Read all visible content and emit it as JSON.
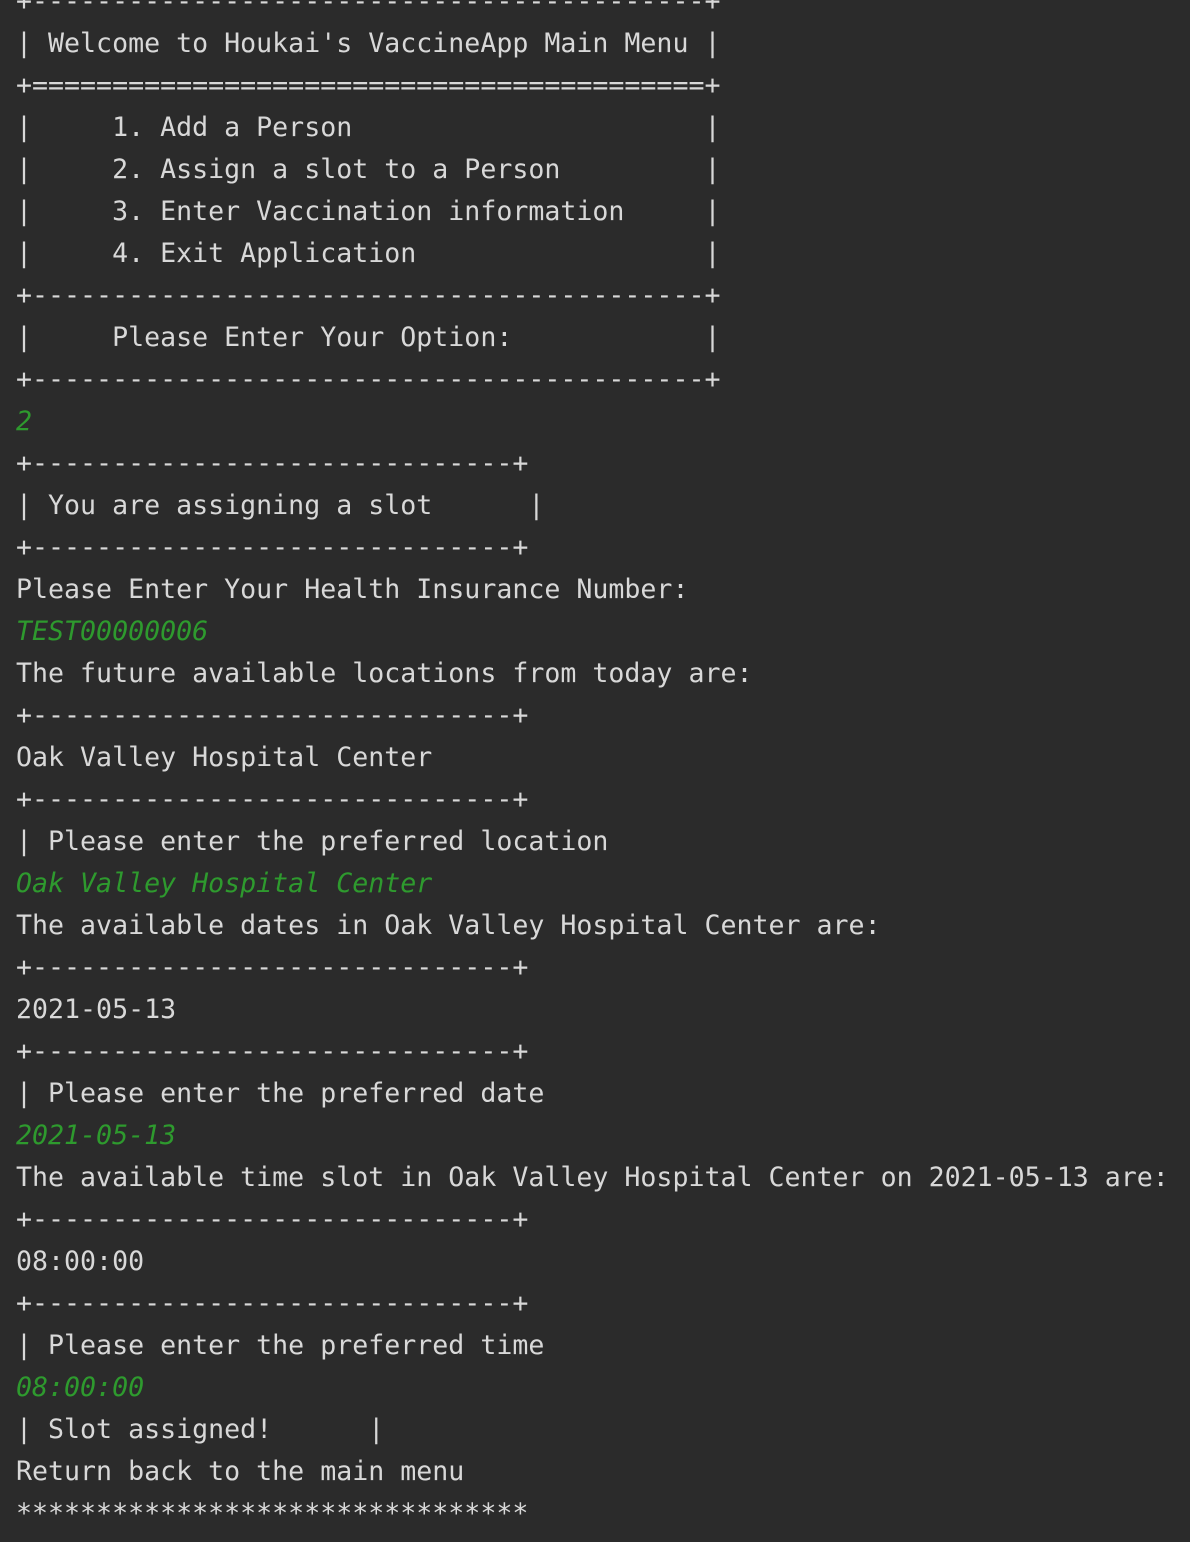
{
  "console": {
    "lines": [
      {
        "text": "+------------------------------------------+",
        "kind": "output"
      },
      {
        "text": "| Welcome to Houkai's VaccineApp Main Menu |",
        "kind": "output"
      },
      {
        "text": "+==========================================+",
        "kind": "output"
      },
      {
        "text": "|     1. Add a Person                      |",
        "kind": "output"
      },
      {
        "text": "|     2. Assign a slot to a Person         |",
        "kind": "output"
      },
      {
        "text": "|     3. Enter Vaccination information     |",
        "kind": "output"
      },
      {
        "text": "|     4. Exit Application                  |",
        "kind": "output"
      },
      {
        "text": "+------------------------------------------+",
        "kind": "output"
      },
      {
        "text": "|     Please Enter Your Option:            |",
        "kind": "output"
      },
      {
        "text": "+------------------------------------------+",
        "kind": "output"
      },
      {
        "text": "2",
        "kind": "input"
      },
      {
        "text": "+------------------------------+",
        "kind": "output"
      },
      {
        "text": "| You are assigning a slot      |",
        "kind": "output"
      },
      {
        "text": "+------------------------------+",
        "kind": "output"
      },
      {
        "text": "Please Enter Your Health Insurance Number:",
        "kind": "output"
      },
      {
        "text": "TEST00000006",
        "kind": "input"
      },
      {
        "text": "The future available locations from today are:",
        "kind": "output"
      },
      {
        "text": "+------------------------------+",
        "kind": "output"
      },
      {
        "text": "Oak Valley Hospital Center",
        "kind": "output"
      },
      {
        "text": "+------------------------------+",
        "kind": "output"
      },
      {
        "text": "| Please enter the preferred location",
        "kind": "output"
      },
      {
        "text": "Oak Valley Hospital Center",
        "kind": "input"
      },
      {
        "text": "The available dates in Oak Valley Hospital Center are:",
        "kind": "output"
      },
      {
        "text": "+------------------------------+",
        "kind": "output"
      },
      {
        "text": "2021-05-13",
        "kind": "output"
      },
      {
        "text": "+------------------------------+",
        "kind": "output"
      },
      {
        "text": "| Please enter the preferred date",
        "kind": "output"
      },
      {
        "text": "2021-05-13",
        "kind": "input"
      },
      {
        "text": "The available time slot in Oak Valley Hospital Center on 2021-05-13 are:",
        "kind": "output"
      },
      {
        "text": "+------------------------------+",
        "kind": "output"
      },
      {
        "text": "08:00:00",
        "kind": "output"
      },
      {
        "text": "+------------------------------+",
        "kind": "output"
      },
      {
        "text": "| Please enter the preferred time",
        "kind": "output"
      },
      {
        "text": "08:00:00",
        "kind": "input"
      },
      {
        "text": "| Slot assigned!      |",
        "kind": "output"
      },
      {
        "text": "Return back to the main menu",
        "kind": "output"
      },
      {
        "text": "********************************",
        "kind": "output"
      }
    ]
  }
}
